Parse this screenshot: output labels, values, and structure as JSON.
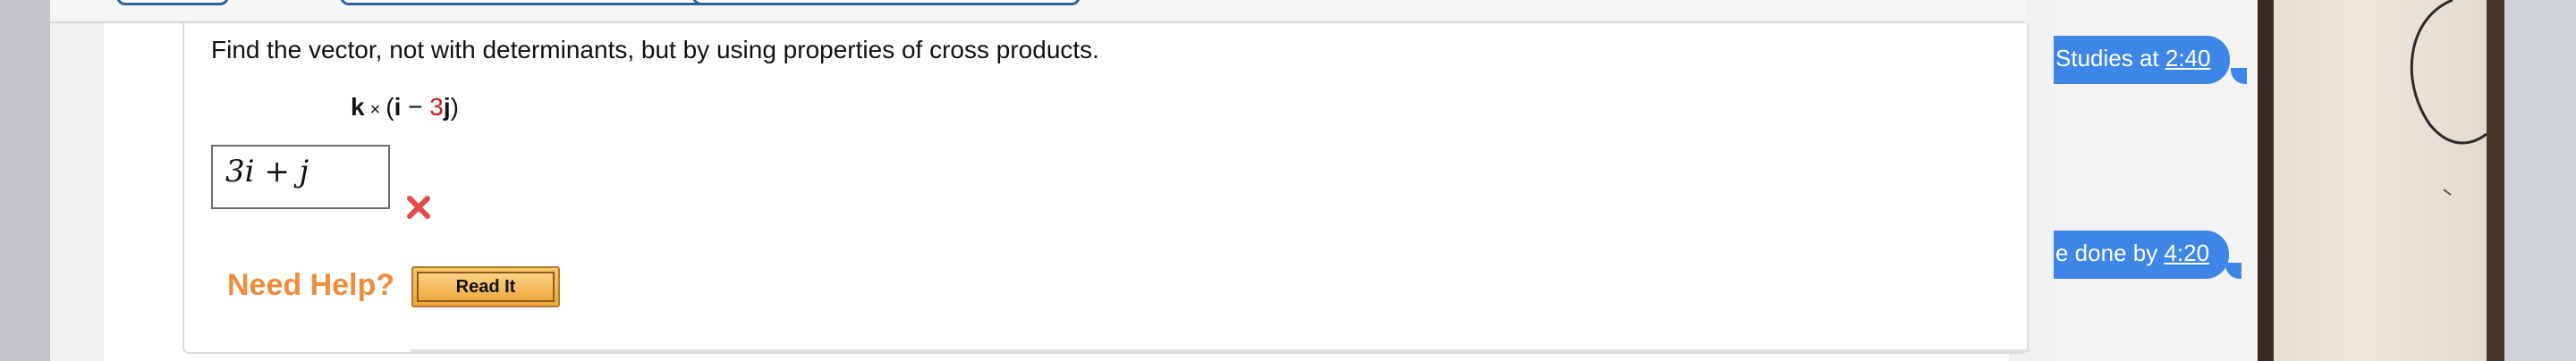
{
  "question": {
    "prompt": "Find the vector, not with determinants, but by using properties of cross products.",
    "expression": {
      "k": "k",
      "times": "×",
      "open": "(",
      "i": "i",
      "minus": " − ",
      "coef": "3",
      "j": "j",
      "close": ")"
    },
    "answer_value": "3i + j",
    "status_icon": "red-x-icon"
  },
  "help": {
    "label": "Need Help?",
    "read_it_button": "Read It"
  },
  "chat": {
    "messages": [
      {
        "text": "Studies at ",
        "time": "2:40"
      },
      {
        "text": "e done by ",
        "time": "4:20"
      }
    ]
  },
  "colors": {
    "need_help": "#ef8d3a",
    "chat_bubble": "#3d86e8",
    "wrong_icon": "#e34b4b",
    "coefficient_red": "#d11b1b"
  }
}
